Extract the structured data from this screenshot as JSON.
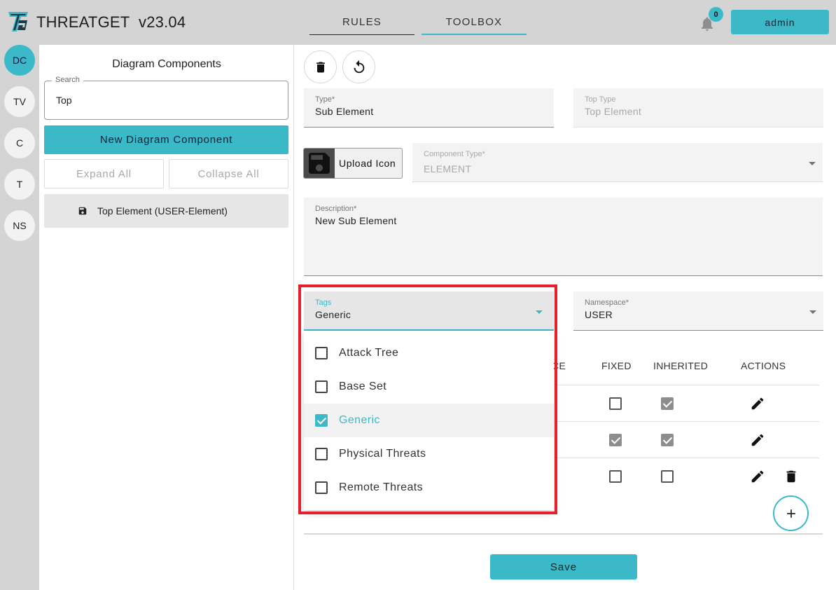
{
  "header": {
    "app_name": "THREATGET",
    "version": "v23.04",
    "tabs": [
      {
        "label": "RULES"
      },
      {
        "label": "TOOLBOX"
      }
    ],
    "notification_count": "0",
    "user": "admin"
  },
  "rail": {
    "items": [
      {
        "label": "DC",
        "active": true
      },
      {
        "label": "TV"
      },
      {
        "label": "C"
      },
      {
        "label": "T"
      },
      {
        "label": "NS"
      }
    ]
  },
  "sidebar": {
    "title": "Diagram Components",
    "search": {
      "label": "Search",
      "value": "Top"
    },
    "new_button": "New Diagram Component",
    "expand_all": "Expand All",
    "collapse_all": "Collapse All",
    "tree_item": "Top Element (USER-Element)"
  },
  "form": {
    "type": {
      "label": "Type*",
      "value": "Sub Element"
    },
    "top_type": {
      "label": "Top Type",
      "value": "Top Element"
    },
    "upload_label": "Upload Icon",
    "component_type": {
      "label": "Component Type*",
      "value": "ELEMENT"
    },
    "description": {
      "label": "Description*",
      "value": "New Sub Element"
    },
    "tags": {
      "label": "Tags",
      "value": "Generic"
    },
    "namespace": {
      "label": "Namespace*",
      "value": "USER"
    }
  },
  "table": {
    "headers": {
      "partial": "CE",
      "fixed": "FIXED",
      "inherited": "INHERITED",
      "actions": "ACTIONS"
    },
    "rows": [
      {
        "fixed": false,
        "inherited": true,
        "edit": true,
        "delete": false
      },
      {
        "fixed": true,
        "inherited": true,
        "edit": true,
        "delete": false
      },
      {
        "fixed": false,
        "inherited": false,
        "edit": true,
        "delete": true
      }
    ]
  },
  "tags_menu": {
    "options": [
      {
        "label": "Attack Tree",
        "checked": false
      },
      {
        "label": "Base Set",
        "checked": false
      },
      {
        "label": "Generic",
        "checked": true
      },
      {
        "label": "Physical Threats",
        "checked": false
      },
      {
        "label": "Remote Threats",
        "checked": false
      }
    ]
  },
  "save_label": "Save",
  "colors": {
    "accent": "#3bb9c9",
    "highlight": "#e3202b",
    "header_bg": "#d4d4d4"
  }
}
